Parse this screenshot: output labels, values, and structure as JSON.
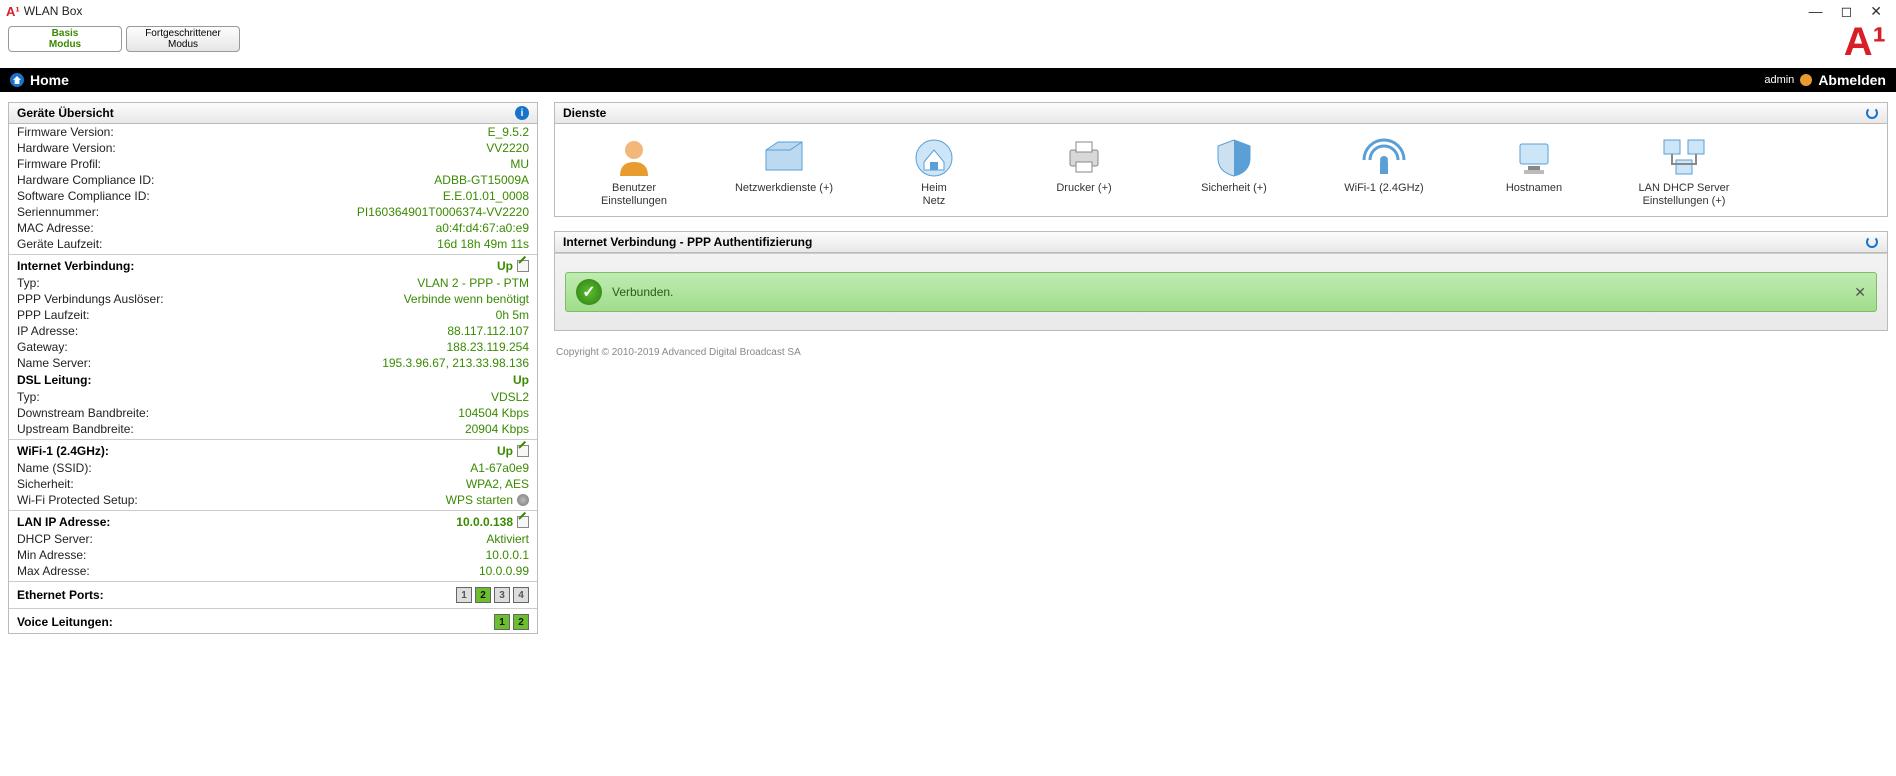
{
  "window": {
    "title": "WLAN Box",
    "logo": "A¹"
  },
  "modes": {
    "basic": "Basis\nModus",
    "advanced": "Fortgeschrittener\nModus"
  },
  "brand": "A¹",
  "topbar": {
    "home": "Home",
    "user": "admin",
    "logout": "Abmelden"
  },
  "overview": {
    "title": "Geräte Übersicht",
    "rows": [
      {
        "k": "Firmware Version:",
        "v": "E_9.5.2"
      },
      {
        "k": "Hardware Version:",
        "v": "VV2220"
      },
      {
        "k": "Firmware Profil:",
        "v": "MU"
      },
      {
        "k": "Hardware Compliance ID:",
        "v": "ADBB-GT15009A"
      },
      {
        "k": "Software Compliance ID:",
        "v": "E.E.01.01_0008"
      },
      {
        "k": "Seriennummer:",
        "v": "PI160364901T0006374-VV2220"
      },
      {
        "k": "MAC Adresse:",
        "v": "a0:4f:d4:67:a0:e9"
      },
      {
        "k": "Geräte Laufzeit:",
        "v": "16d 18h 49m 11s"
      }
    ]
  },
  "internet": {
    "title": "Internet Verbindung:",
    "status": "Up",
    "rows": [
      {
        "k": "Typ:",
        "v": "VLAN 2 - PPP - PTM"
      },
      {
        "k": "PPP Verbindungs Auslöser:",
        "v": "Verbinde wenn benötigt"
      },
      {
        "k": "PPP Laufzeit:",
        "v": "0h 5m"
      },
      {
        "k": "IP Adresse:",
        "v": "88.117.112.107"
      },
      {
        "k": "Gateway:",
        "v": "188.23.119.254"
      },
      {
        "k": "Name Server:",
        "v": "195.3.96.67, 213.33.98.136"
      }
    ]
  },
  "dsl": {
    "title": "DSL Leitung:",
    "status": "Up",
    "rows": [
      {
        "k": "Typ:",
        "v": "VDSL2"
      },
      {
        "k": "Downstream Bandbreite:",
        "v": "104504 Kbps"
      },
      {
        "k": "Upstream Bandbreite:",
        "v": "20904 Kbps"
      }
    ]
  },
  "wifi": {
    "title": "WiFi-1 (2.4GHz):",
    "status": "Up",
    "rows": [
      {
        "k": "Name (SSID):",
        "v": "A1-67a0e9"
      },
      {
        "k": "Sicherheit:",
        "v": "WPA2, AES"
      }
    ],
    "wps_label": "Wi-Fi Protected Setup:",
    "wps_value": "WPS starten"
  },
  "lan": {
    "title": "LAN IP Adresse:",
    "value": "10.0.0.138",
    "rows": [
      {
        "k": "DHCP Server:",
        "v": "Aktiviert"
      },
      {
        "k": "Min Adresse:",
        "v": "10.0.0.1"
      },
      {
        "k": "Max Adresse:",
        "v": "10.0.0.99"
      }
    ]
  },
  "eth": {
    "title": "Ethernet Ports:",
    "ports": [
      {
        "n": "1",
        "on": false
      },
      {
        "n": "2",
        "on": true
      },
      {
        "n": "3",
        "on": false
      },
      {
        "n": "4",
        "on": false
      }
    ]
  },
  "voice": {
    "title": "Voice Leitungen:",
    "ports": [
      {
        "n": "1",
        "on": true
      },
      {
        "n": "2",
        "on": true
      }
    ]
  },
  "services": {
    "title": "Dienste",
    "items": [
      {
        "name": "user-settings",
        "label": "Benutzer\nEinstellungen"
      },
      {
        "name": "network-services",
        "label": "Netzwerkdienste (+)"
      },
      {
        "name": "home-network",
        "label": "Heim\nNetz"
      },
      {
        "name": "printers",
        "label": "Drucker (+)"
      },
      {
        "name": "security",
        "label": "Sicherheit (+)"
      },
      {
        "name": "wifi",
        "label": "WiFi-1 (2.4GHz)"
      },
      {
        "name": "hostnames",
        "label": "Hostnamen"
      },
      {
        "name": "dhcp",
        "label": "LAN DHCP Server\nEinstellungen (+)"
      }
    ]
  },
  "auth": {
    "title": "Internet Verbindung - PPP Authentifizierung",
    "msg": "Verbunden."
  },
  "copyright": "Copyright © 2010-2019 Advanced Digital Broadcast SA"
}
